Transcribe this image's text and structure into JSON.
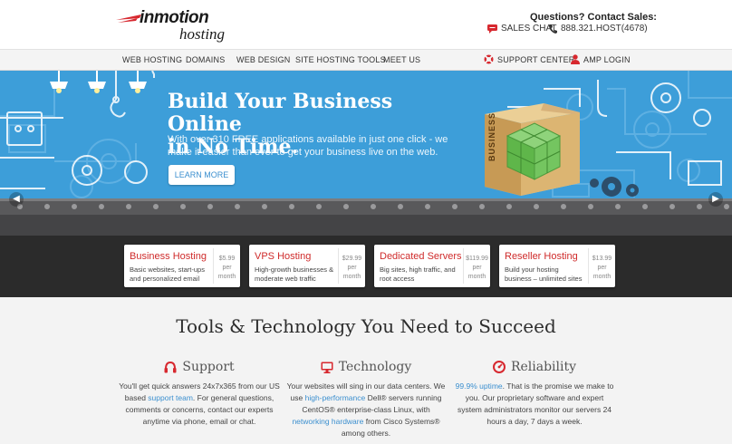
{
  "brand": {
    "name": "inmotion",
    "sub": "hosting",
    "accent": "#d7282f"
  },
  "contact": {
    "title": "Questions? Contact Sales:",
    "chat_label": "SALES CHAT",
    "phone": "888.321.HOST(4678)"
  },
  "nav": {
    "items": [
      "WEB HOSTING",
      "DOMAINS",
      "WEB DESIGN",
      "SITE HOSTING TOOLS",
      "MEET US"
    ],
    "support": "SUPPORT CENTER",
    "login": "AMP LOGIN"
  },
  "hero": {
    "title_line1": "Build Your Business Online",
    "title_line2": "in No Time.",
    "description": "With over 310 FREE applications available in just one click - we make it easier than ever to get your business live on the web.",
    "cta": "LEARN MORE",
    "box_label": "BUSINESS"
  },
  "plans": [
    {
      "name": "Business Hosting",
      "desc": "Basic websites, start-ups and personalized email",
      "price": "$5.99",
      "per": "per",
      "period": "month"
    },
    {
      "name": "VPS Hosting",
      "desc": "High-growth businesses & moderate web traffic",
      "price": "$29.99",
      "per": "per",
      "period": "month"
    },
    {
      "name": "Dedicated Servers",
      "desc": "Big sites, high traffic, and root access",
      "price": "$119.99",
      "per": "per",
      "period": "month"
    },
    {
      "name": "Reseller Hosting",
      "desc": "Build your hosting business – unlimited sites",
      "price": "$13.99",
      "per": "per",
      "period": "month"
    }
  ],
  "tools": {
    "title": "Tools & Technology You Need to Succeed",
    "support": {
      "heading": "Support",
      "t1": "You'll get quick answers 24x7x365 from our US based ",
      "link": "support team",
      "t2": ". For general questions, comments or concerns, contact our experts anytime via phone, email or chat."
    },
    "technology": {
      "heading": "Technology",
      "t1": "Your websites will sing in our data centers. We use ",
      "link1": "high-performance",
      "t2": " Dell® servers running CentOS® enterprise-class Linux, with ",
      "link2": "networking hardware",
      "t3": " from Cisco Systems® among others."
    },
    "reliability": {
      "heading": "Reliability",
      "link": "99.9% uptime",
      "t1": ". That is the promise we make to you. Our proprietary software and expert system administrators monitor our servers 24 hours a day, 7 days a week."
    }
  },
  "icons": {
    "chat": "chat-bubble-icon",
    "phone": "phone-icon",
    "support": "lifebuoy-icon",
    "login": "user-icon",
    "headphones": "headphones-icon",
    "monitor": "monitor-icon",
    "gauge": "gauge-icon"
  }
}
